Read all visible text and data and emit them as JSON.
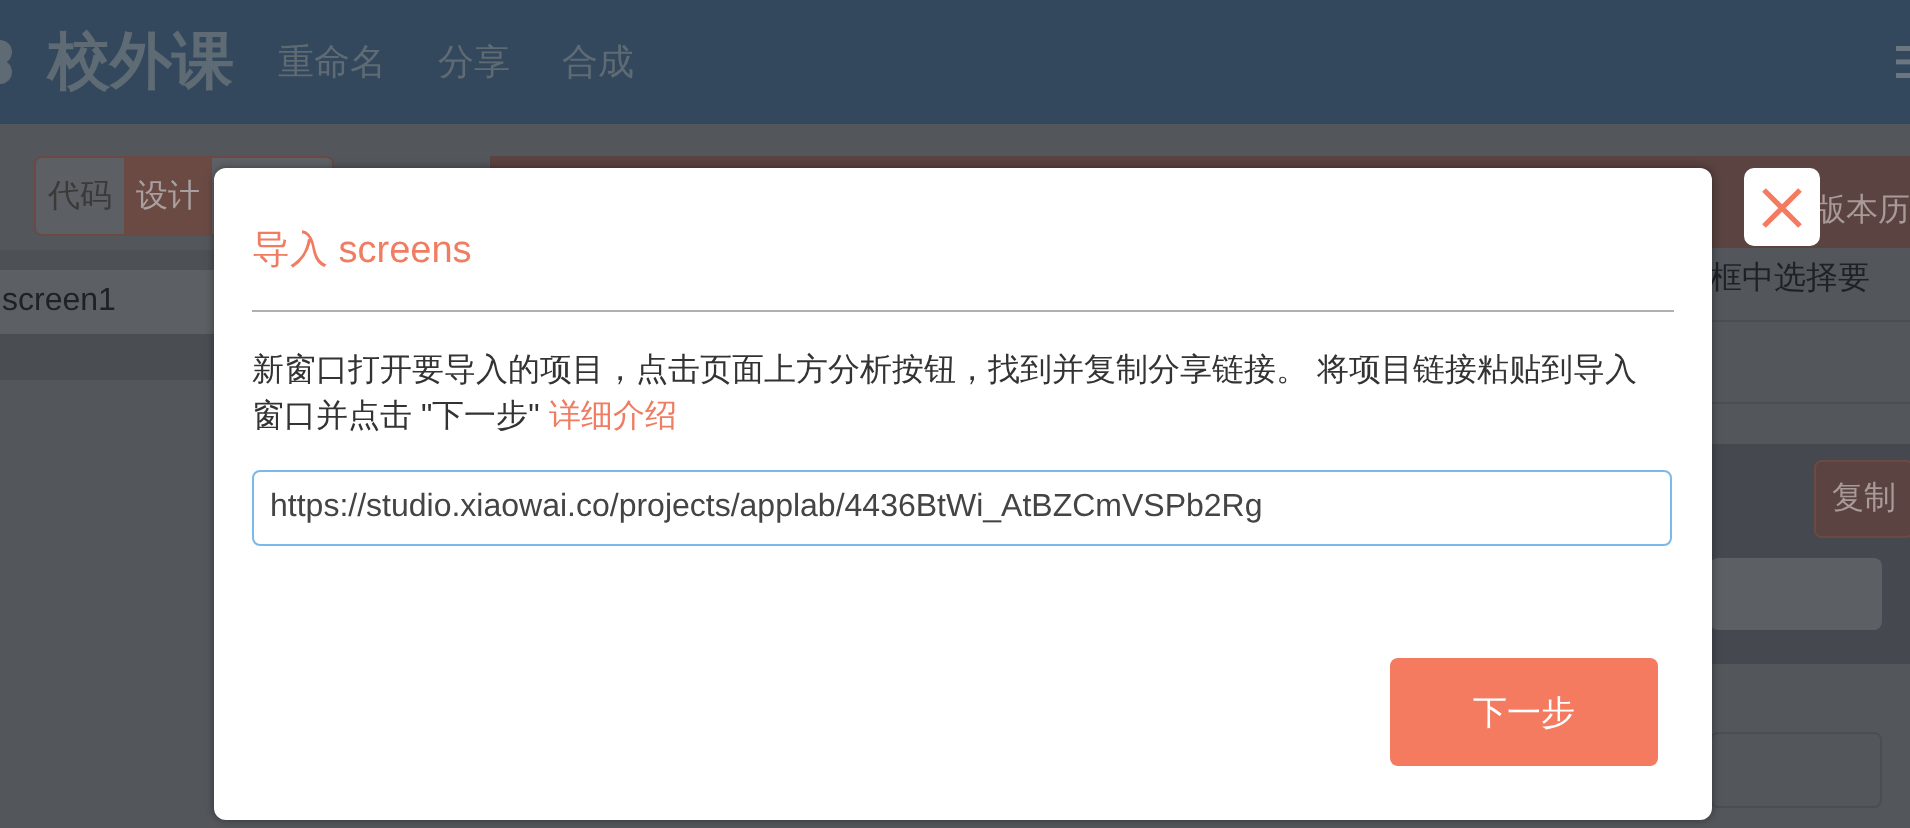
{
  "header": {
    "logo": "校外课",
    "nav": [
      "重命名",
      "分享",
      "合成"
    ]
  },
  "toolbar": {
    "view_tabs": [
      {
        "label": "代码",
        "selected": false
      },
      {
        "label": "设计",
        "selected": true
      }
    ],
    "version_button": "版本历"
  },
  "sidebar": {
    "items": [
      {
        "label": "screen1",
        "selected": false
      }
    ]
  },
  "right_panel": {
    "hint": "框中选择要",
    "copy_button": "复制"
  },
  "dialog": {
    "title": "导入 screens",
    "description": "新窗口打开要导入的项目，点击页面上方分析按钮，找到并复制分享链接。 将项目链接粘贴到导入窗口并点击 \"下一步\" ",
    "link": "详细介绍",
    "url_value": "https://studio.xiaowai.co/projects/applab/4436BtWi_AtBZCmVSPb2Rg",
    "next_button": "下一步"
  }
}
